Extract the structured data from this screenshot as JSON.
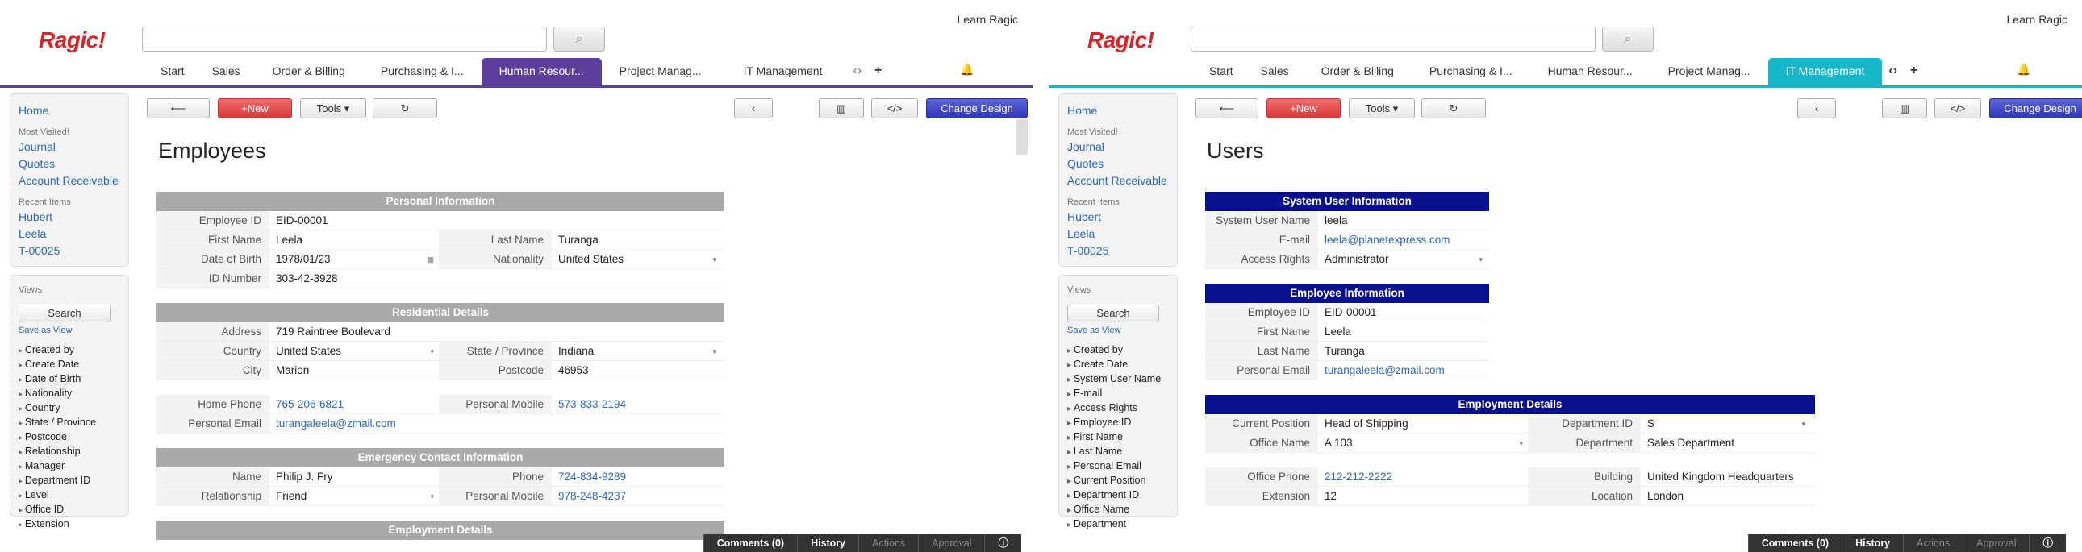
{
  "left": {
    "logo": "Ragic!",
    "learn": "Learn Ragic",
    "tabs": [
      "Start",
      "Sales",
      "Order & Billing",
      "Purchasing & I...",
      "Human Resour...",
      "Project Manag...",
      "IT Management"
    ],
    "accent": "#5b3f9a",
    "nav": {
      "home": "Home",
      "most_visited": "Most Visited!",
      "mv1": "Journal",
      "mv2": "Quotes",
      "mv3": "Account Receivable",
      "recent": "Recent Items",
      "r1": "Hubert",
      "r2": "Leela",
      "r3": "T-00025"
    },
    "views": {
      "label": "Views",
      "search": "Search",
      "save": "Save as View",
      "filters": [
        "Created by",
        "Create Date",
        "Date of Birth",
        "Nationality",
        "Country",
        "State / Province",
        "Postcode",
        "Relationship",
        "Manager",
        "Department ID",
        "Level",
        "Office ID",
        "Extension"
      ]
    },
    "toolbar": {
      "back": "⟵",
      "new": "+New",
      "tools": "Tools ▾",
      "refresh": "↻",
      "prev": "‹",
      "chart": "▥",
      "code": "</>",
      "design": "Change Design"
    },
    "title": "Employees",
    "sections": [
      {
        "name": "Personal Information",
        "rows": [
          {
            "l1": "Employee ID",
            "v1": "EID-00001",
            "l2": "",
            "v2": ""
          },
          {
            "l1": "First Name",
            "v1": "Leela",
            "l2": "Last Name",
            "v2": "Turanga"
          },
          {
            "l1": "Date of Birth",
            "v1": "1978/01/23",
            "l2": "Nationality",
            "v2": "United States"
          },
          {
            "l1": "ID Number",
            "v1": "303-42-3928",
            "l2": "",
            "v2": ""
          }
        ]
      },
      {
        "name": "Residential Details",
        "rows": [
          {
            "l1": "Address",
            "v1": "719 Raintree Boulevard",
            "l2": "",
            "v2": ""
          },
          {
            "l1": "Country",
            "v1": "United States",
            "l2": "State / Province",
            "v2": "Indiana"
          },
          {
            "l1": "City",
            "v1": "Marion",
            "l2": "Postcode",
            "v2": "46953"
          },
          {
            "l1": "Home Phone",
            "v1": "765-206-6821",
            "l2": "Personal Mobile",
            "v2": "573-833-2194"
          },
          {
            "l1": "Personal Email",
            "v1": "turangaleela@zmail.com",
            "l2": "",
            "v2": ""
          }
        ]
      },
      {
        "name": "Emergency Contact Information",
        "rows": [
          {
            "l1": "Name",
            "v1": "Philip J. Fry",
            "l2": "Phone",
            "v2": "724-834-9289"
          },
          {
            "l1": "Relationship",
            "v1": "Friend",
            "l2": "Personal Mobile",
            "v2": "978-248-4237"
          }
        ]
      },
      {
        "name": "Employment Details"
      }
    ]
  },
  "right": {
    "logo": "Ragic!",
    "learn": "Learn Ragic",
    "tabs": [
      "Start",
      "Sales",
      "Order & Billing",
      "Purchasing & I...",
      "Human Resour...",
      "Project Manag...",
      "IT Management"
    ],
    "accent": "#17b6c9",
    "nav": {
      "home": "Home",
      "most_visited": "Most Visited!",
      "mv1": "Journal",
      "mv2": "Quotes",
      "mv3": "Account Receivable",
      "recent": "Recent Items",
      "r1": "Hubert",
      "r2": "Leela",
      "r3": "T-00025"
    },
    "views": {
      "label": "Views",
      "search": "Search",
      "save": "Save as View",
      "filters": [
        "Created by",
        "Create Date",
        "System User Name",
        "E-mail",
        "Access Rights",
        "Employee ID",
        "First Name",
        "Last Name",
        "Personal Email",
        "Current Position",
        "Department ID",
        "Office Name",
        "Department"
      ]
    },
    "toolbar": {
      "back": "⟵",
      "new": "+New",
      "tools": "Tools ▾",
      "refresh": "↻",
      "prev": "‹",
      "chart": "▥",
      "code": "</>",
      "design": "Change Design"
    },
    "title": "Users",
    "sections": [
      {
        "name": "System User Information",
        "rows": [
          {
            "l1": "System User Name",
            "v1": "leela"
          },
          {
            "l1": "E-mail",
            "v1": "leela@planetexpress.com"
          },
          {
            "l1": "Access Rights",
            "v1": "Administrator"
          }
        ]
      },
      {
        "name": "Employee Information",
        "rows": [
          {
            "l1": "Employee ID",
            "v1": "EID-00001"
          },
          {
            "l1": "First Name",
            "v1": "Leela"
          },
          {
            "l1": "Last Name",
            "v1": "Turanga"
          },
          {
            "l1": "Personal Email",
            "v1": "turangaleela@zmail.com"
          }
        ]
      },
      {
        "name": "Employment Details",
        "rows": [
          {
            "l1": "Current Position",
            "v1": "Head of Shipping",
            "l2": "Department ID",
            "v2": "S"
          },
          {
            "l1": "Office Name",
            "v1": "A 103",
            "l2": "Department",
            "v2": "Sales Department"
          },
          {
            "l1": "Office Phone",
            "v1": "212-212-2222",
            "l2": "Building",
            "v2": "United Kingdom Headquarters"
          },
          {
            "l1": "Extension",
            "v1": "12",
            "l2": "Location",
            "v2": "London"
          }
        ]
      }
    ]
  },
  "bottom": {
    "comments": "Comments (0)",
    "history": "History",
    "actions": "Actions",
    "approval": "Approval",
    "info": "ⓘ"
  }
}
